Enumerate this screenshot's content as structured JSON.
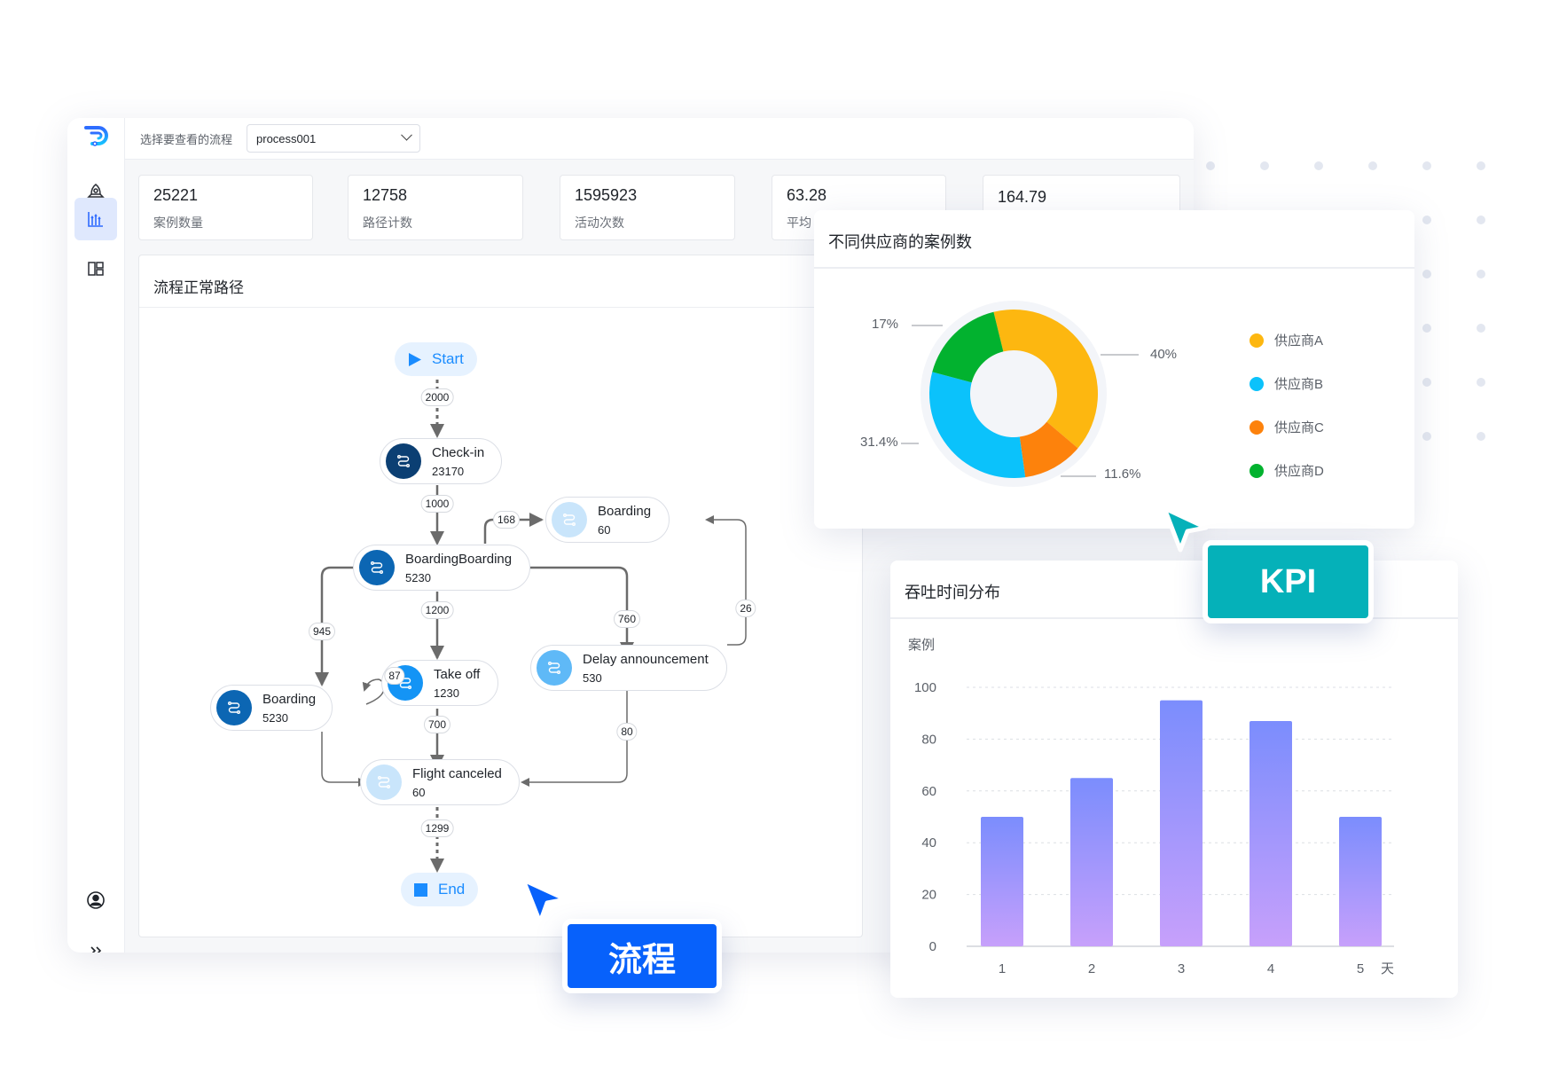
{
  "app": {
    "logo": "p-logo"
  },
  "sidebar": {
    "items": [
      {
        "icon": "rocket-icon",
        "active": false
      },
      {
        "icon": "bar-chart-icon",
        "active": true
      },
      {
        "icon": "layout-icon",
        "active": false
      }
    ],
    "bottom": [
      {
        "icon": "user-circle-icon"
      },
      {
        "icon": "double-chevron-right-icon"
      }
    ]
  },
  "topbar": {
    "label": "选择要查看的流程",
    "select_value": "process001"
  },
  "kpis": [
    {
      "value": "25221",
      "label": "案例数量"
    },
    {
      "value": "12758",
      "label": "路径计数"
    },
    {
      "value": "1595923",
      "label": "活动次数"
    },
    {
      "value": "63.28",
      "label": "平均"
    },
    {
      "value": "164.79",
      "label": ""
    }
  ],
  "flow": {
    "title": "流程正常路径",
    "start_label": "Start",
    "end_label": "End",
    "nodes": [
      {
        "id": "checkin",
        "name": "Check-in",
        "count": "23170",
        "color": "#0b3f73"
      },
      {
        "id": "boarding_top",
        "name": "Boarding",
        "count": "60",
        "color": "#c9e5fb"
      },
      {
        "id": "boardingboarding",
        "name": "BoardingBoarding",
        "count": "5230",
        "color": "#0c66b3"
      },
      {
        "id": "takeoff",
        "name": "Take off",
        "count": "1230",
        "color": "#1494f5"
      },
      {
        "id": "delay",
        "name": "Delay announcement",
        "count": "530",
        "color": "#5fb9f7"
      },
      {
        "id": "boarding_left",
        "name": "Boarding",
        "count": "5230",
        "color": "#0c66b3"
      },
      {
        "id": "canceled",
        "name": "Flight canceled",
        "count": "60",
        "color": "#c9e5fb"
      }
    ],
    "edges": [
      {
        "from": "start",
        "to": "checkin",
        "label": "2000"
      },
      {
        "from": "checkin",
        "to": "boardingboarding",
        "label": "1000"
      },
      {
        "from": "boardingboarding",
        "to": "boarding_top",
        "label": "168"
      },
      {
        "from": "delay",
        "to": "boarding_top",
        "label": "26"
      },
      {
        "from": "boardingboarding",
        "to": "boarding_left",
        "label": "945"
      },
      {
        "from": "boardingboarding",
        "to": "takeoff",
        "label": "1200"
      },
      {
        "from": "boardingboarding",
        "to": "delay",
        "label": "760"
      },
      {
        "from": "boarding_left",
        "to": "boarding_left",
        "label": "87"
      },
      {
        "from": "takeoff",
        "to": "canceled",
        "label": "700"
      },
      {
        "from": "delay",
        "to": "canceled",
        "label": "80"
      },
      {
        "from": "canceled",
        "to": "end",
        "label": "1299"
      }
    ]
  },
  "chart_data": [
    {
      "type": "pie",
      "title": "不同供应商的案例数",
      "categories": [
        "供应商A",
        "供应商B",
        "供应商C",
        "供应商D"
      ],
      "values": [
        40,
        31.4,
        11.6,
        17
      ],
      "labels": [
        "40%",
        "31.4%",
        "11.6%",
        "17%"
      ],
      "colors": [
        "#fdb710",
        "#0bc2fb",
        "#fd820c",
        "#02b22f"
      ],
      "donut": true,
      "legend": "right"
    },
    {
      "type": "bar",
      "title": "吞吐时间分布",
      "categories": [
        "1",
        "2",
        "3",
        "4",
        "5"
      ],
      "values": [
        50,
        65,
        95,
        87,
        50
      ],
      "xlabel": "天",
      "ylabel": "案例",
      "ylim": [
        0,
        100
      ],
      "yticks": [
        0,
        20,
        40,
        60,
        80,
        100
      ],
      "grid": true,
      "colors": {
        "top": "#7b8dfd",
        "bottom": "#c7a0fb"
      }
    }
  ],
  "badges": {
    "kpi": {
      "label": "KPI",
      "color": "#05b1b9"
    },
    "flow": {
      "label": "流程",
      "color": "#0761fb"
    }
  }
}
